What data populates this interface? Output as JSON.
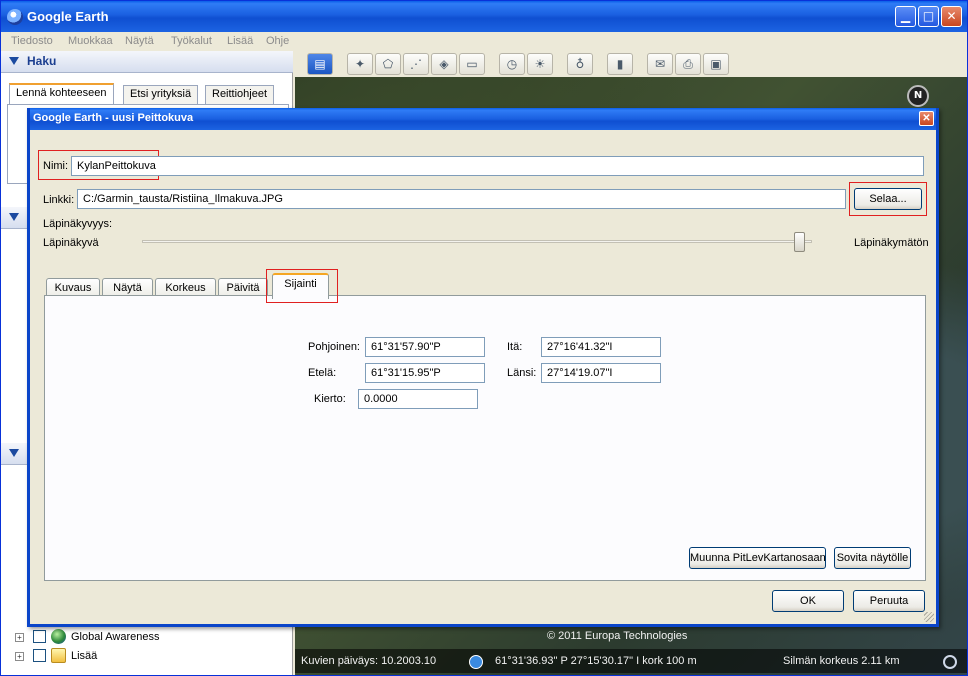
{
  "app": {
    "title": "Google Earth"
  },
  "menu": [
    "Tiedosto",
    "Muokkaa",
    "Näytä",
    "Työkalut",
    "Lisää",
    "Ohje"
  ],
  "search_panel": {
    "header": "Haku",
    "tabs": [
      "Lennä kohteeseen",
      "Etsi yrityksiä",
      "Reittiohjeet"
    ]
  },
  "layers": [
    {
      "label": "Global Awareness",
      "icon": "globe-icon"
    },
    {
      "label": "Lisää",
      "icon": "folder-icon"
    }
  ],
  "toolbar": {
    "buttons": [
      "sidebar-toggle-icon",
      "add-placemark-icon",
      "add-polygon-icon",
      "add-path-icon",
      "add-image-overlay-icon",
      "record-tour-icon",
      "historical-imagery-icon",
      "sunlight-icon",
      "switch-planet-icon",
      "ruler-icon",
      "email-icon",
      "print-icon",
      "save-image-icon"
    ]
  },
  "map": {
    "compass_label": "N",
    "credit": "© 2011 Europa Technologies",
    "status": {
      "imagery_date": "Kuvien päiväys: 10.2003.10",
      "position": "61°31'36.93\" P  27°15'30.17\" I  kork  100 m",
      "eye_alt": "Silmän korkeus   2.11 km"
    }
  },
  "dialog": {
    "title": "Google Earth - uusi Peittokuva",
    "name_label": "Nimi:",
    "name_value": "KylanPeittokuva",
    "link_label": "Linkki:",
    "link_value": "C:/Garmin_tausta/Ristiina_Ilmakuva.JPG",
    "browse_button": "Selaa...",
    "opacity_label": "Läpinäkyvyys:",
    "opacity_min": "Läpinäkyvä",
    "opacity_max": "Läpinäkymätön",
    "opacity_value": 0.99,
    "tabs": [
      "Kuvaus",
      "Näytä",
      "Korkeus",
      "Päivitä",
      "Sijainti"
    ],
    "active_tab": "Sijainti",
    "location": {
      "north_label": "Pohjoinen:",
      "north_value": "61°31'57.90\"P",
      "east_label": "Itä:",
      "east_value": "27°16'41.32\"I",
      "south_label": "Etelä:",
      "south_value": "61°31'15.95\"P",
      "west_label": "Länsi:",
      "west_value": "27°14'19.07\"I",
      "rotation_label": "Kierto:",
      "rotation_value": "0.0000"
    },
    "convert_button": "Muunna PitLevKartanosaan",
    "fit_button": "Sovita näytölle",
    "ok_button": "OK",
    "cancel_button": "Peruuta"
  },
  "colors": {
    "highlight": "#e02020",
    "title_blue": "#0a45c9"
  }
}
